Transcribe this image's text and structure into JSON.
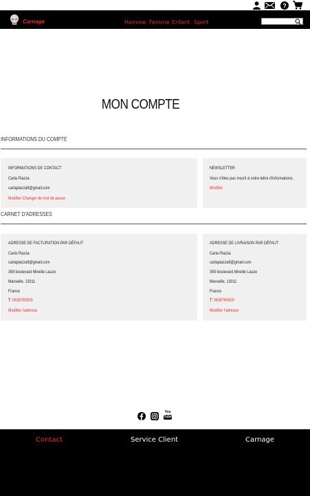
{
  "utility_icons": [
    "user-icon",
    "mail-icon",
    "help-icon",
    "cart-icon"
  ],
  "header": {
    "brand": "Carnage",
    "nav": [
      "Homme",
      "Femme",
      "Enfant",
      "Sport"
    ],
    "search": {
      "value": "",
      "placeholder": ""
    }
  },
  "page_title": "MON COMPTE",
  "account_info": {
    "title": "INFORMATIONS DU COMPTE",
    "contact": {
      "heading": "INFORMATIONS DE CONTACT",
      "name": "Carla Piazza",
      "email": "carlapiazza9@gmail.com",
      "edit_link": "Modifier",
      "change_password_link": "Changer de mot de passe"
    },
    "newsletter": {
      "heading": "NEWSLETTER",
      "text": "Vous n'êtes pas inscrit à notre lettre d'informations.",
      "edit_link": "Modifier"
    }
  },
  "address_book": {
    "title": "CARNET D'ADRESSES",
    "billing": {
      "heading": "ADRESSE DE FACTURATION PAR DÉFAUT",
      "name": "Carla Piazza",
      "email": "carlapiazza9@gmail.com",
      "street": "359 boulevard Mireille Lauze",
      "city": "Marseille, 13011",
      "country": "France",
      "phone_label": "T:",
      "phone": "0638780929",
      "edit_link": "Modifier l'adresse"
    },
    "shipping": {
      "heading": "ADRESSE DE LIVRAISON PAR DÉFAUT",
      "name": "Carla Piazza",
      "email": "carlapiazza9@gmail.com",
      "street": "359 boulevard Mireille Lauze",
      "city": "Marseille, 13011",
      "country": "France",
      "phone_label": "T:",
      "phone": "0638780929",
      "edit_link": "Modifier l'adresse"
    }
  },
  "social": {
    "icons": [
      "facebook-icon",
      "instagram-icon",
      "youtube-icon"
    ],
    "youtube_top": "You",
    "youtube_bottom": "Tube"
  },
  "footer": {
    "links": [
      "Contact",
      "Service Client",
      "Carnage"
    ],
    "colors": [
      "#e5322d",
      "#ffffff",
      "#ffffff"
    ]
  },
  "colors": {
    "accent": "#e5322d",
    "header_bg": "#000000",
    "box_bg": "#f0f0f0"
  }
}
